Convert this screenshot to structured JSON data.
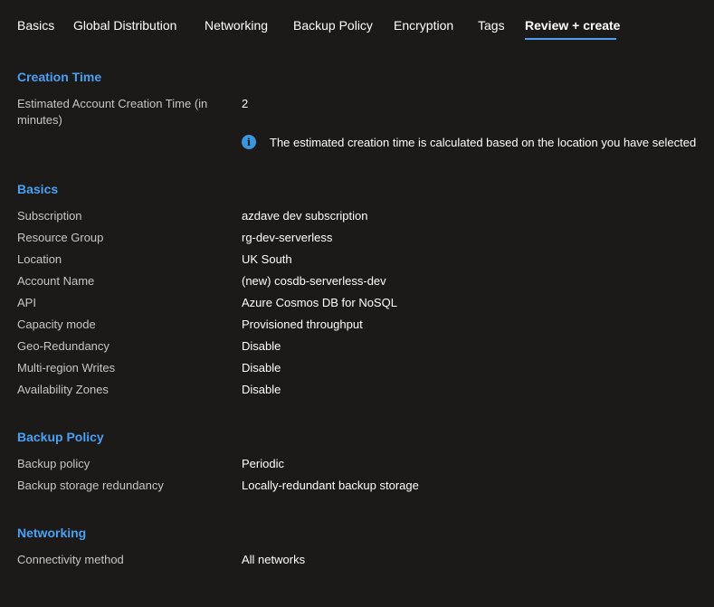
{
  "tabs": [
    {
      "label": "Basics"
    },
    {
      "label": "Global Distribution"
    },
    {
      "label": "Networking"
    },
    {
      "label": "Backup Policy"
    },
    {
      "label": "Encryption"
    },
    {
      "label": "Tags"
    },
    {
      "label": "Review + create",
      "active": true
    }
  ],
  "creation_time": {
    "title": "Creation Time",
    "label": "Estimated Account Creation Time (in minutes)",
    "value": "2",
    "info": "The estimated creation time is calculated based on the location you have selected",
    "info_icon": "info-icon",
    "info_icon_glyph": "i"
  },
  "basics": {
    "title": "Basics",
    "rows": [
      {
        "label": "Subscription",
        "value": "azdave dev subscription"
      },
      {
        "label": "Resource Group",
        "value": "rg-dev-serverless"
      },
      {
        "label": "Location",
        "value": "UK South"
      },
      {
        "label": "Account Name",
        "value": "(new) cosdb-serverless-dev"
      },
      {
        "label": "API",
        "value": "Azure Cosmos DB for NoSQL"
      },
      {
        "label": "Capacity mode",
        "value": "Provisioned throughput"
      },
      {
        "label": "Geo-Redundancy",
        "value": "Disable"
      },
      {
        "label": "Multi-region Writes",
        "value": "Disable"
      },
      {
        "label": "Availability Zones",
        "value": "Disable"
      }
    ]
  },
  "backup_policy": {
    "title": "Backup Policy",
    "rows": [
      {
        "label": "Backup policy",
        "value": "Periodic"
      },
      {
        "label": "Backup storage redundancy",
        "value": "Locally-redundant backup storage"
      }
    ]
  },
  "networking": {
    "title": "Networking",
    "rows": [
      {
        "label": "Connectivity method",
        "value": "All networks"
      }
    ]
  },
  "colors": {
    "background": "#1b1a19",
    "section_title": "#4ba0f2",
    "label": "#c8c6c4",
    "value": "#ffffff",
    "active_tab_underline": "#4f9ff0"
  }
}
